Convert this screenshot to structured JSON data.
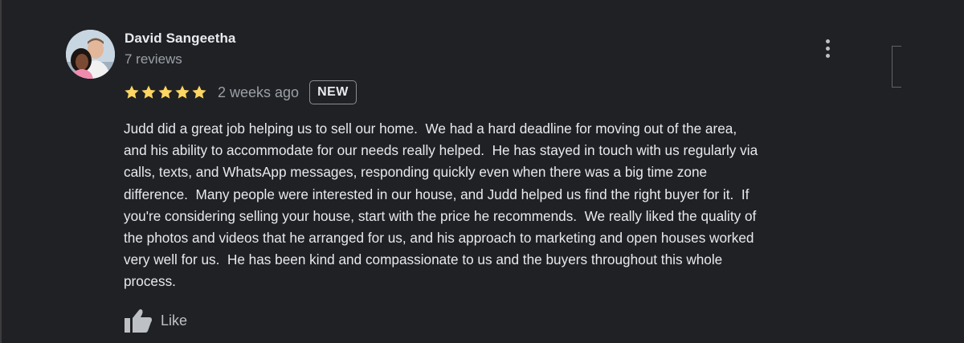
{
  "review": {
    "author": "David Sangeetha",
    "review_count": "7 reviews",
    "rating": 5,
    "rating_max": 5,
    "date": "2 weeks ago",
    "badge": "NEW",
    "text": "Judd did a great job helping us to sell our home.  We had a hard deadline for moving out of the area,\nand his ability to accommodate for our needs really helped.  He has stayed in touch with us regularly via\ncalls, texts, and WhatsApp messages, responding quickly even when there was a big time zone\ndifference.  Many people were interested in our house, and Judd helped us find the right buyer for it.  If\nyou're considering selling your house, start with the price he recommends.  We really liked the quality of\nthe photos and videos that he arranged for us, and his approach to marketing and open houses worked\nvery well for us.  He has been kind and compassionate to us and the buyers throughout this whole\nprocess."
  },
  "actions": {
    "like_label": "Like"
  },
  "icons": {
    "avatar": "avatar-photo",
    "star": "star-icon",
    "more": "more-vert-icon",
    "like": "thumb-up-icon"
  },
  "colors": {
    "background": "#202124",
    "star": "#fdd663",
    "text_primary": "#e8eaed",
    "text_secondary": "#9aa0a6"
  }
}
